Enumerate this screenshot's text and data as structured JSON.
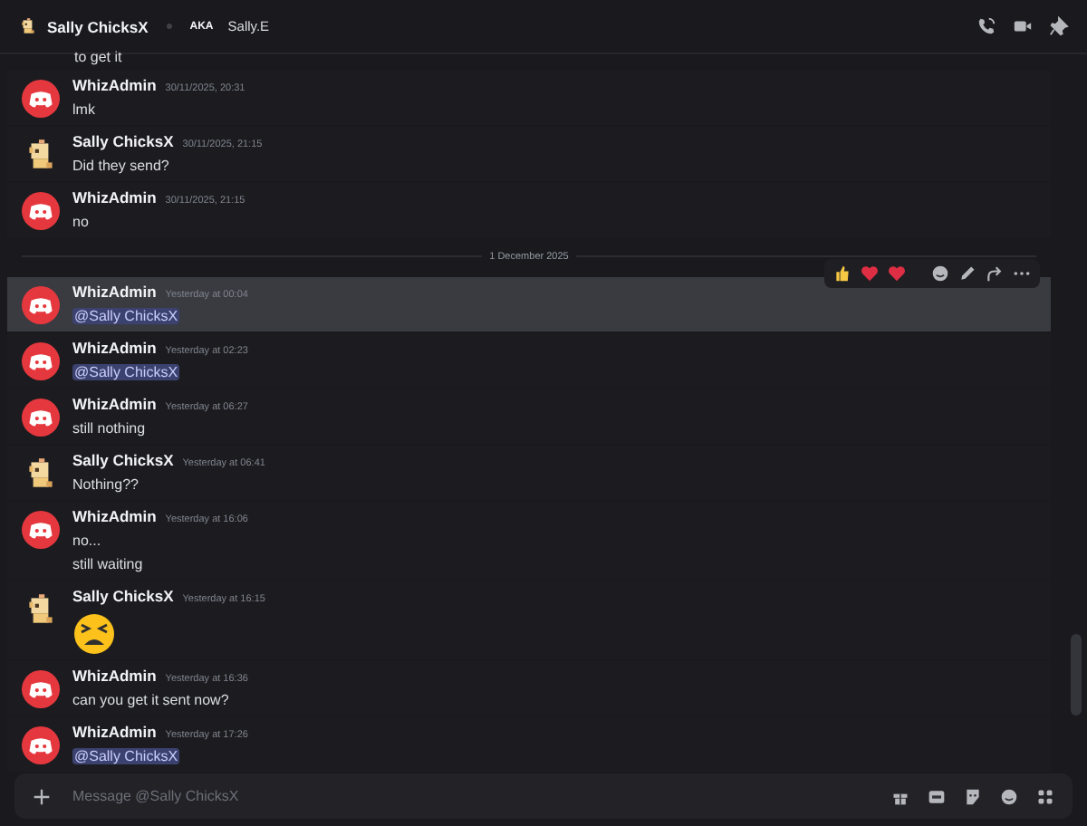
{
  "header": {
    "name": "Sally ChicksX",
    "aka_label": "AKA",
    "aka_name": "Sally.E"
  },
  "top_continuation": "to get it",
  "messages": [
    {
      "kind": "admin",
      "author": "WhizAdmin",
      "time": "30/11/2025, 20:31",
      "hovered": false,
      "lines": [
        {
          "kind": "text",
          "text": "lmk"
        }
      ]
    },
    {
      "kind": "sally",
      "author": "Sally ChicksX",
      "time": "30/11/2025, 21:15",
      "hovered": false,
      "lines": [
        {
          "kind": "text",
          "text": "Did they send?"
        }
      ]
    },
    {
      "kind": "admin",
      "author": "WhizAdmin",
      "time": "30/11/2025, 21:15",
      "hovered": false,
      "lines": [
        {
          "kind": "text",
          "text": "no"
        }
      ]
    },
    {
      "kind": "divider",
      "text": "1 December 2025"
    },
    {
      "kind": "admin",
      "author": "WhizAdmin",
      "time": "Yesterday at 00:04",
      "hovered": true,
      "lines": [
        {
          "kind": "mention",
          "text": "@Sally ChicksX"
        }
      ]
    },
    {
      "kind": "admin",
      "author": "WhizAdmin",
      "time": "Yesterday at 02:23",
      "hovered": false,
      "lines": [
        {
          "kind": "mention",
          "text": "@Sally ChicksX"
        }
      ]
    },
    {
      "kind": "admin",
      "author": "WhizAdmin",
      "time": "Yesterday at 06:27",
      "hovered": false,
      "lines": [
        {
          "kind": "text",
          "text": "still nothing"
        }
      ]
    },
    {
      "kind": "sally",
      "author": "Sally ChicksX",
      "time": "Yesterday at 06:41",
      "hovered": false,
      "lines": [
        {
          "kind": "text",
          "text": "Nothing??"
        }
      ]
    },
    {
      "kind": "admin",
      "author": "WhizAdmin",
      "time": "Yesterday at 16:06",
      "hovered": false,
      "lines": [
        {
          "kind": "text",
          "text": "no..."
        },
        {
          "kind": "text",
          "text": "still waiting"
        }
      ]
    },
    {
      "kind": "sally",
      "author": "Sally ChicksX",
      "time": "Yesterday at 16:15",
      "hovered": false,
      "lines": [
        {
          "kind": "emoji"
        }
      ]
    },
    {
      "kind": "admin",
      "author": "WhizAdmin",
      "time": "Yesterday at 16:36",
      "hovered": false,
      "lines": [
        {
          "kind": "text",
          "text": "can you get it sent now?"
        }
      ]
    },
    {
      "kind": "admin",
      "author": "WhizAdmin",
      "time": "Yesterday at 17:26",
      "hovered": false,
      "lines": [
        {
          "kind": "mention",
          "text": "@Sally ChicksX"
        }
      ]
    }
  ],
  "composer": {
    "placeholder": "Message @Sally ChicksX"
  }
}
